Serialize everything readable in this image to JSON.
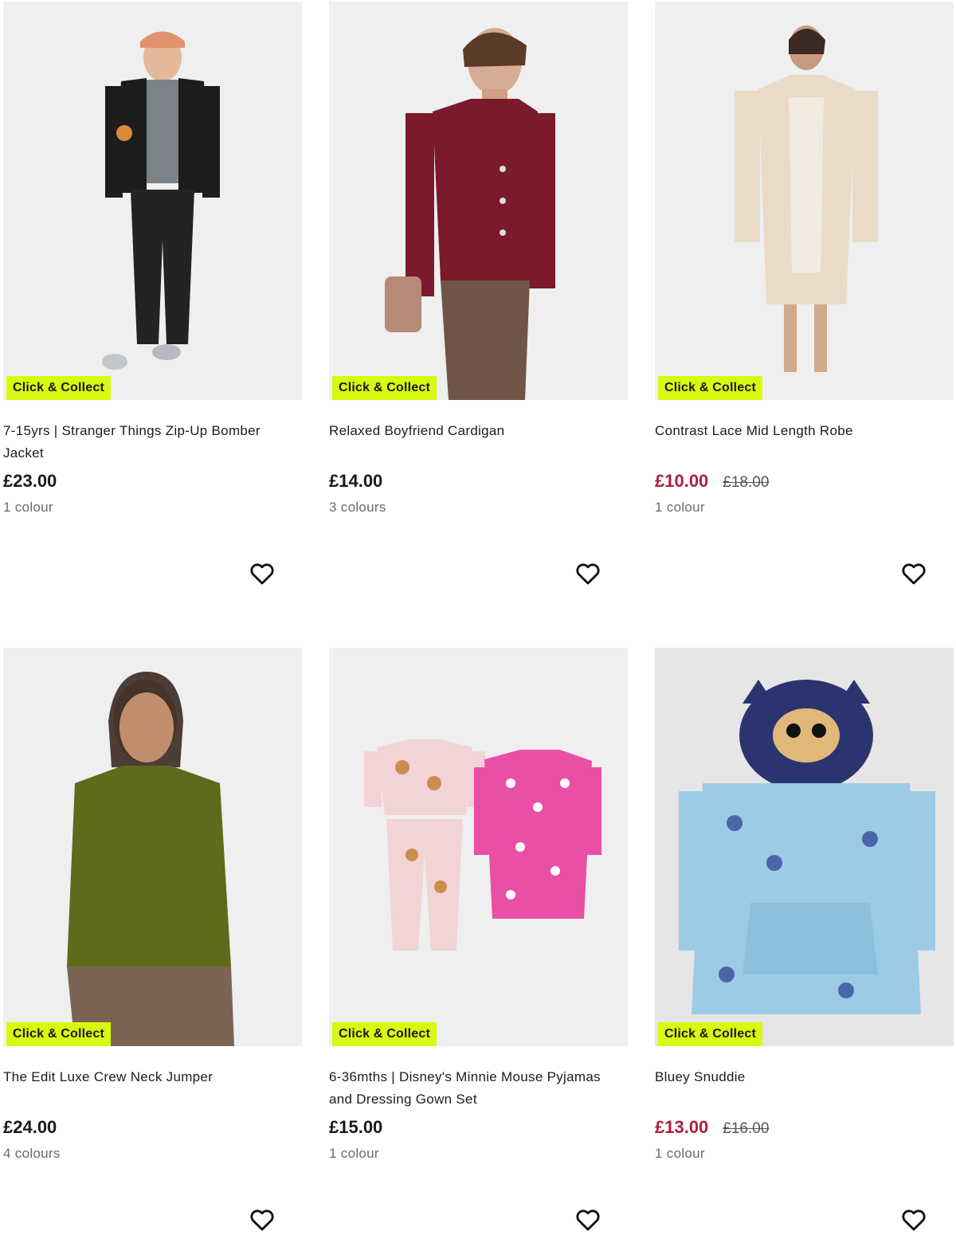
{
  "colors": {
    "badge_bg": "#d9f90f",
    "sale": "#ad1f3d"
  },
  "badge_label": "Click & Collect",
  "favourite_icon": "heart-outline-icon",
  "products": [
    {
      "title": "7-15yrs | Stranger Things Zip-Up Bomber Jacket",
      "price": "£23.00",
      "old_price": "",
      "colours": "1 colour"
    },
    {
      "title": "Relaxed Boyfriend Cardigan",
      "price": "£14.00",
      "old_price": "",
      "colours": "3 colours"
    },
    {
      "title": "Contrast Lace Mid Length Robe",
      "price": "£10.00",
      "old_price": "£18.00",
      "colours": "1 colour"
    },
    {
      "title": "The Edit Luxe Crew Neck Jumper",
      "price": "£24.00",
      "old_price": "",
      "colours": "4 colours"
    },
    {
      "title": "6-36mths | Disney's Minnie Mouse Pyjamas and Dressing Gown Set",
      "price": "£15.00",
      "old_price": "",
      "colours": "1 colour"
    },
    {
      "title": "Bluey Snuddie",
      "price": "£13.00",
      "old_price": "£16.00",
      "colours": "1 colour"
    }
  ]
}
